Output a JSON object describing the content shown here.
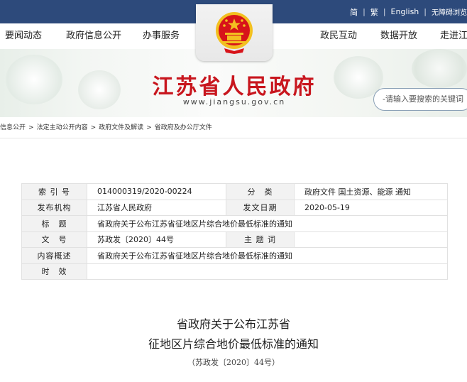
{
  "topbar": {
    "simplified": "简",
    "traditional": "繁",
    "english": "English",
    "accessibility": "无障碍浏览"
  },
  "nav": {
    "items": [
      "要闻动态",
      "政府信息公开",
      "办事服务",
      "政民互动",
      "数据开放",
      "走进江"
    ]
  },
  "banner": {
    "title": "江苏省人民政府",
    "url": "www.jiangsu.gov.cn",
    "search_placeholder": "-请输入要搜索的关键词"
  },
  "breadcrumb": {
    "items": [
      "信息公开",
      "法定主动公开内容",
      "政府文件及解读",
      "省政府及办公厅文件"
    ],
    "separator": ">"
  },
  "meta": {
    "index_label": "索 引 号",
    "index_value": "014000319/2020-00224",
    "category_label": "分　类",
    "category_value": "政府文件 国土资源、能源 通知",
    "publisher_label": "发布机构",
    "publisher_value": "江苏省人民政府",
    "date_label": "发文日期",
    "date_value": "2020-05-19",
    "title_label": "标　题",
    "title_value": "省政府关于公布江苏省征地区片综合地价最低标准的通知",
    "docno_label": "文　号",
    "docno_value": "苏政发〔2020〕44号",
    "subject_label": "主 题 词",
    "subject_value": "",
    "summary_label": "内容概述",
    "summary_value": "省政府关于公布江苏省征地区片综合地价最低标准的通知",
    "validity_label": "时　效",
    "validity_value": ""
  },
  "document": {
    "title_line1": "省政府关于公布江苏省",
    "title_line2": "征地区片综合地价最低标准的通知",
    "number": "（苏政发〔2020〕44号）"
  },
  "colors": {
    "topbar": "#2d4a7b",
    "title_red": "#c8161e",
    "emblem_red": "#d7141a",
    "emblem_gold": "#f3c020"
  }
}
